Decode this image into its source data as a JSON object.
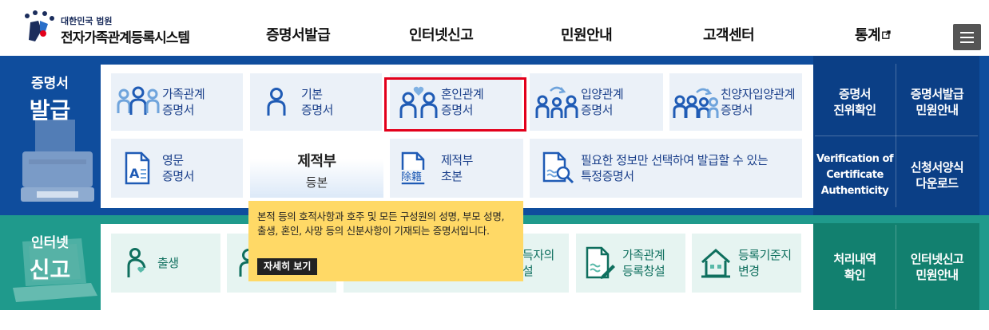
{
  "header": {
    "logo_small": "대한민국 법원",
    "logo_big": "전자가족관계등록시스템",
    "nav": [
      {
        "label": "증명서발급"
      },
      {
        "label": "인터넷신고"
      },
      {
        "label": "민원안내"
      },
      {
        "label": "고객센터"
      },
      {
        "label": "통계",
        "icon": "external-link-icon"
      }
    ],
    "menu_icon": "hamburger-menu-icon"
  },
  "certificate": {
    "section_line1": "증명서",
    "section_line2": "발급",
    "tiles": [
      {
        "line1": "가족관계",
        "line2": "증명서",
        "icon": "family-icon"
      },
      {
        "line1": "기본",
        "line2": "증명서",
        "icon": "person-icon"
      },
      {
        "line1": "혼인관계",
        "line2": "증명서",
        "icon": "couple-heart-icon"
      },
      {
        "line1": "입양관계",
        "line2": "증명서",
        "icon": "adoption-icon"
      },
      {
        "line1": "친양자입양관계",
        "line2": "증명서",
        "icon": "full-adoption-icon"
      },
      {
        "line1": "영문",
        "line2": "증명서",
        "icon": "english-document-icon"
      },
      {
        "title": "제적부",
        "sub": "등본"
      },
      {
        "line1": "제적부",
        "line2": "초본",
        "icon": "excerpt-document-icon",
        "badge": "除籍"
      },
      {
        "line1": "필요한 정보만 선택하여 발급할 수 있는",
        "line2": "특정증명서",
        "icon": "document-search-icon"
      }
    ],
    "side_links": [
      {
        "line1": "증명서",
        "line2": "진위확인"
      },
      {
        "line1": "증명서발급",
        "line2": "민원안내"
      },
      {
        "line1": "Verification of",
        "line2": "Certificate",
        "line3": "Authenticity"
      },
      {
        "line1": "신청서양식",
        "line2": "다운로드"
      }
    ]
  },
  "report": {
    "section_line1": "인터넷",
    "section_line2": "신고",
    "tiles": [
      {
        "line1": "출생",
        "icon": "birth-icon"
      },
      {
        "line1": "",
        "icon": "person-icon"
      },
      {
        "line1": "국적취득자의",
        "line2": "성본창설",
        "icon": "nationality-icon"
      },
      {
        "line1": "가족관계",
        "line2": "등록창설",
        "icon": "registry-create-icon"
      },
      {
        "line1": "등록기준지",
        "line2": "변경",
        "icon": "house-icon"
      }
    ],
    "side_links": [
      {
        "line1": "처리내역",
        "line2": "확인"
      },
      {
        "line1": "인터넷신고",
        "line2": "민원안내"
      }
    ]
  },
  "tooltip": {
    "text": "본적 등의 호적사항과 호주 및 모든 구성원의 성명, 부모 성명, 출생, 혼인, 사망 등의 신분사항이 기재되는 증명서입니다.",
    "button": "자세히 보기"
  },
  "colors": {
    "cert_band": "#0f4d9d",
    "report_band": "#1f9a8c",
    "tile_text": "#1a3f8a",
    "highlight": "#e3001b",
    "tooltip_bg": "#ffd966"
  }
}
